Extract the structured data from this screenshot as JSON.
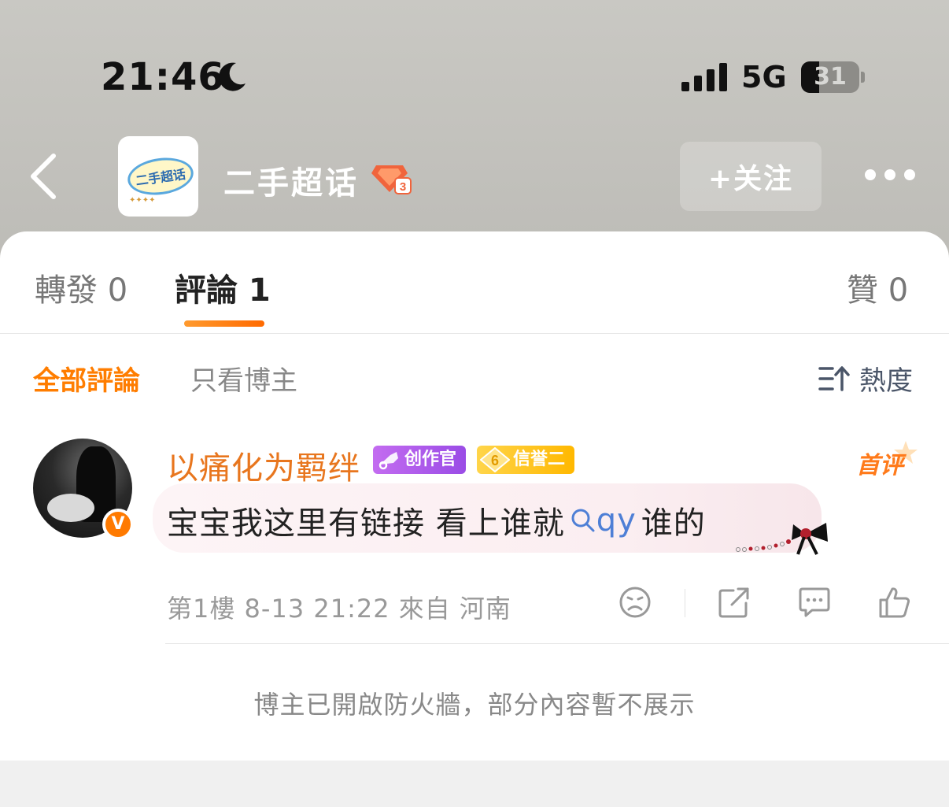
{
  "status_bar": {
    "time": "21:46",
    "network": "5G",
    "battery": "31",
    "battery_level": 0.31
  },
  "nav": {
    "topic_logo_text": "二手超话",
    "title": "二手超话",
    "level": "3",
    "follow_label": "+关注"
  },
  "tabs": [
    {
      "label": "轉發 0",
      "active": false
    },
    {
      "label": "評論 1",
      "active": true
    },
    {
      "label": "贊 0",
      "active": false
    }
  ],
  "filters": {
    "all": "全部評論",
    "blogger_only": "只看博主",
    "sort": "熱度"
  },
  "comment": {
    "username": "以痛化为羁绊",
    "badge_creator": "创作官",
    "badge_credit": "信誉二",
    "badge_credit_level": "6",
    "first_tag": "首评",
    "text_before": "宝宝我这里有链接 看上谁就",
    "link_text": "qy",
    "text_after": "谁的",
    "floor": "第1樓",
    "time": "8-13 21:22",
    "from_label": "來自",
    "location": "河南"
  },
  "notice": "博主已開啟防火牆，部分內容暫不展示",
  "colors": {
    "accent": "#ff7d00",
    "username": "#e8761e",
    "link": "#4e7fd6"
  }
}
